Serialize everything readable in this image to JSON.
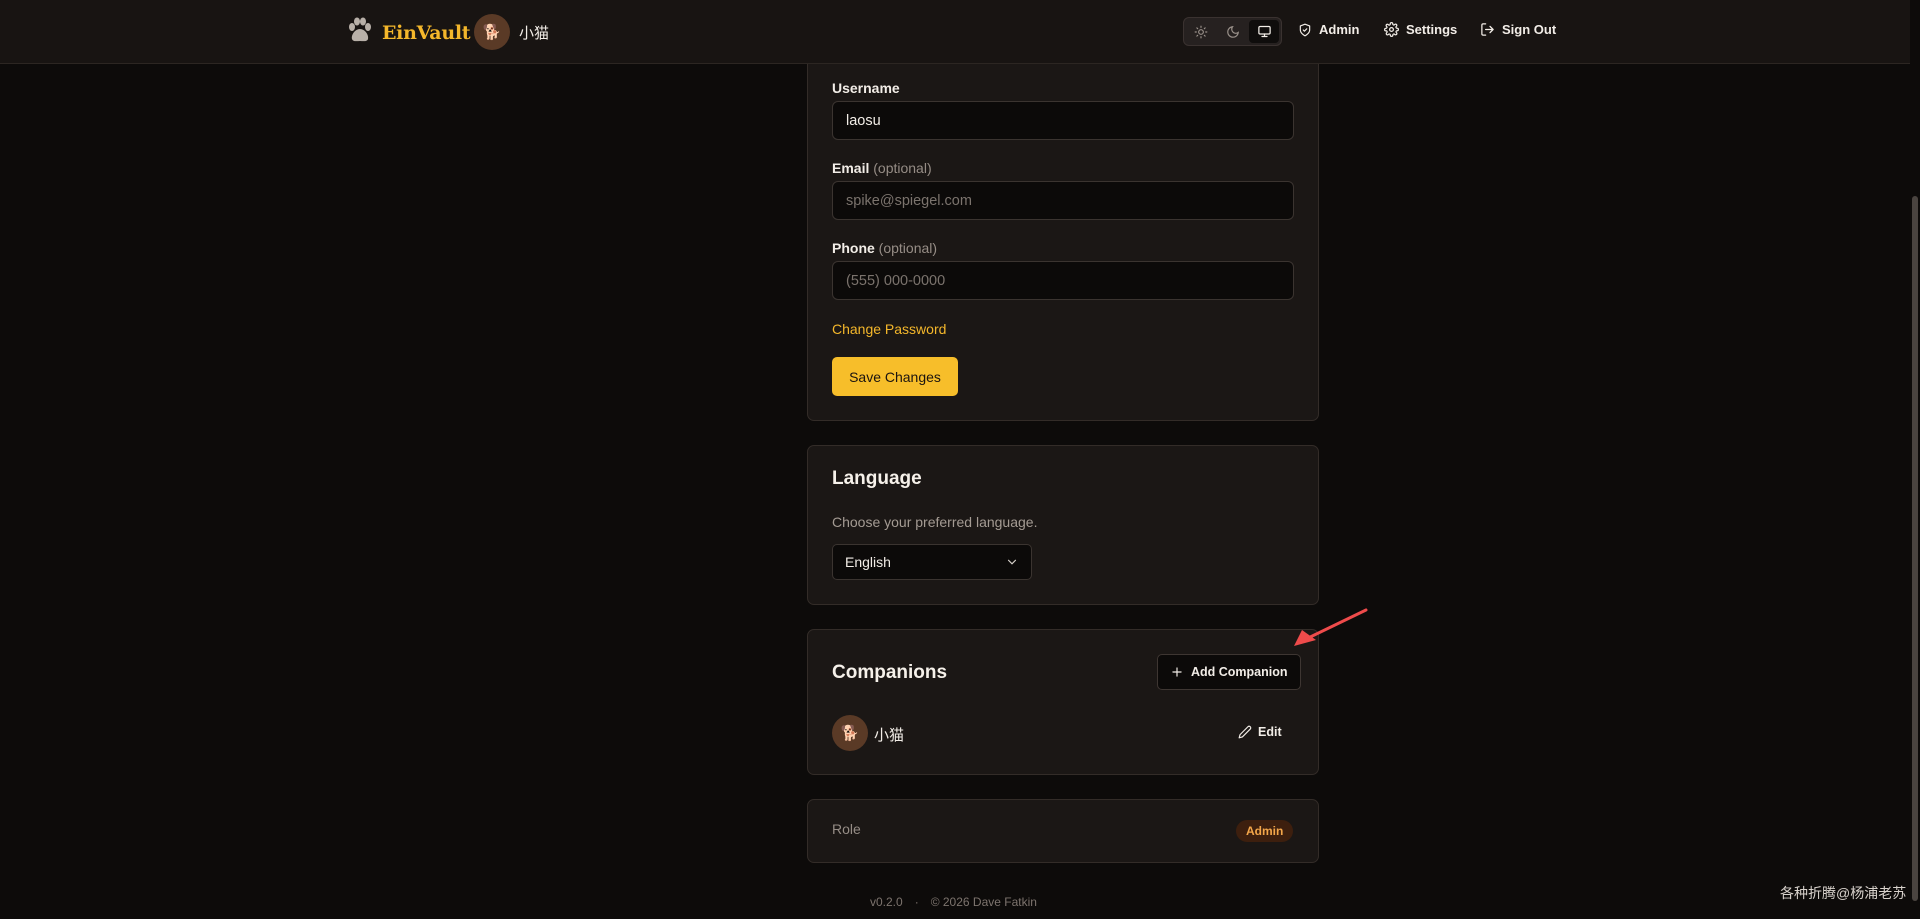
{
  "header": {
    "brand": "EinVault",
    "user_name": "小猫",
    "user_avatar_icon": "dog-emoji",
    "theme_options": [
      "light",
      "dark",
      "system"
    ],
    "theme_selected": "system",
    "nav": {
      "admin": "Admin",
      "settings": "Settings",
      "sign_out": "Sign Out"
    }
  },
  "profile": {
    "username_label": "Username",
    "username_value": "laosu",
    "email_label": "Email",
    "email_optional": "(optional)",
    "email_placeholder": "spike@spiegel.com",
    "phone_label": "Phone",
    "phone_optional": "(optional)",
    "phone_placeholder": "(555) 000-0000",
    "change_password": "Change Password",
    "save_button": "Save Changes"
  },
  "language": {
    "title": "Language",
    "description": "Choose your preferred language.",
    "selected": "English"
  },
  "companions": {
    "title": "Companions",
    "add_button": "Add Companion",
    "items": [
      {
        "name": "小猫",
        "edit_label": "Edit"
      }
    ]
  },
  "role": {
    "label": "Role",
    "value": "Admin"
  },
  "footer": {
    "version": "v0.2.0",
    "separator": "·",
    "copyright": "© 2026 Dave Fatkin"
  },
  "watermark": "各种折腾@杨浦老苏",
  "colors": {
    "accent": "#f7be2a",
    "background": "#0d0b0a",
    "card": "#1b1715",
    "badge_bg": "#3d1f0e",
    "badge_text": "#f3a64a",
    "annotation_arrow": "#ee4b4b"
  }
}
